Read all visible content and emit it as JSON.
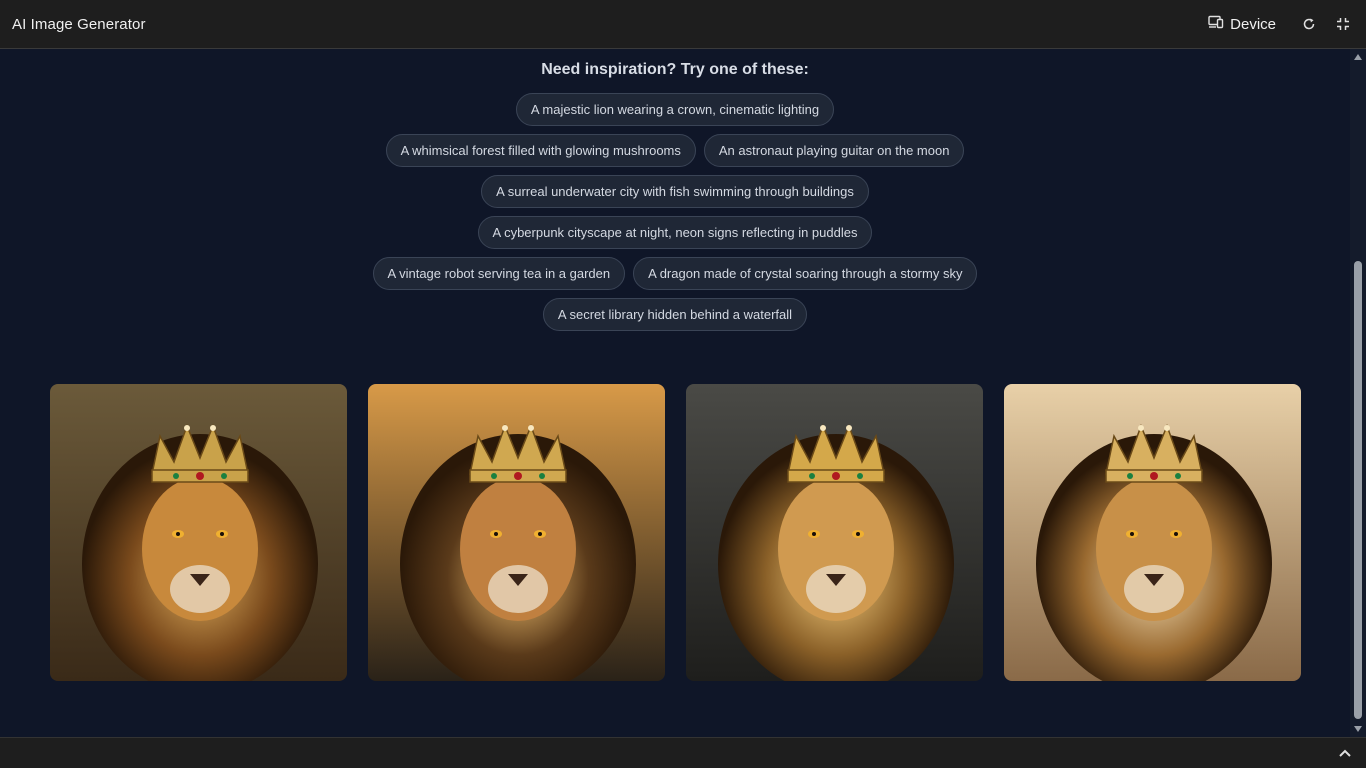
{
  "header": {
    "title": "AI Image Generator",
    "device_label": "Device",
    "icons": [
      "device-icon",
      "refresh-icon",
      "collapse-icon"
    ]
  },
  "inspiration": {
    "title": "Need inspiration? Try one of these:",
    "rows": [
      [
        "A majestic lion wearing a crown, cinematic lighting"
      ],
      [
        "A whimsical forest filled with glowing mushrooms",
        "An astronaut playing guitar on the moon"
      ],
      [
        "A surreal underwater city with fish swimming through buildings"
      ],
      [
        "A cyberpunk cityscape at night, neon signs reflecting in puddles"
      ],
      [
        "A vintage robot serving tea in a garden",
        "A dragon made of crystal soaring through a stormy sky"
      ],
      [
        "A secret library hidden behind a waterfall"
      ]
    ]
  },
  "gallery": {
    "images": [
      {
        "subject": "lion-with-crown",
        "bg": "#8a6a35"
      },
      {
        "subject": "lion-with-crown",
        "bg": "#5a4a30"
      },
      {
        "subject": "lion-with-crown",
        "bg": "#3a3a38"
      },
      {
        "subject": "lion-with-crown",
        "bg": "#c8a676"
      }
    ]
  },
  "colors": {
    "background": "#0f1628",
    "topbar": "#1e1e1e",
    "chip_bg": "#1f2736",
    "chip_border": "#3a4456"
  }
}
